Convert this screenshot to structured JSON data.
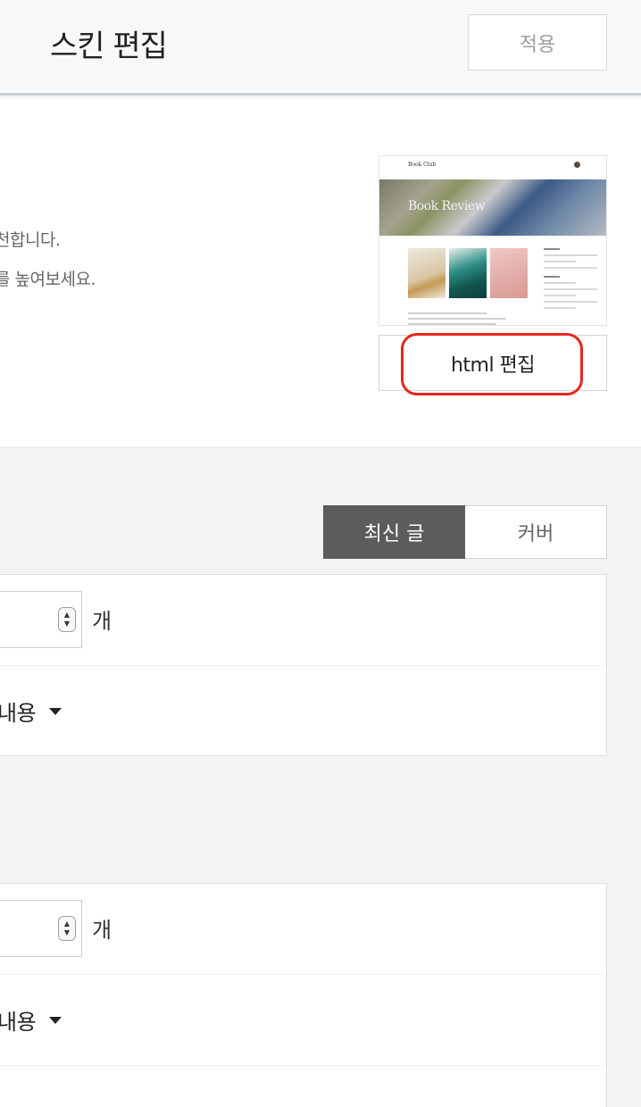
{
  "header": {
    "title": "스킨 편집",
    "apply_label": "적용"
  },
  "skin_info": {
    "desc_line_1": "천합니다.",
    "desc_line_2": "를 높여보세요.",
    "preview": {
      "brand": "Book Club",
      "hero_text": "Book Review"
    },
    "html_edit_label": "html 편집"
  },
  "tabs": {
    "latest_label": "최신 글",
    "cover_label": "커버",
    "active": "latest"
  },
  "panel_1": {
    "unit_label": "개",
    "select_value": "내용"
  },
  "panel_2": {
    "unit_label": "개",
    "select_value": "내용"
  },
  "colors": {
    "accent_highlight": "#e8261d",
    "active_tab": "#5c5c5c"
  }
}
